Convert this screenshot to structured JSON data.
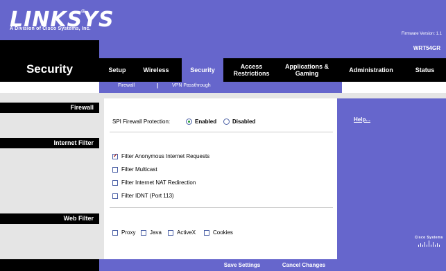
{
  "header": {
    "logo_text": "LINKSYS",
    "logo_reg": "®",
    "tagline": "A Division of Cisco Systems, Inc.",
    "firmware": "Firmware Version: 1.1"
  },
  "section_title": "Security",
  "model_name": "WRT54GR",
  "tabs": [
    {
      "label": "Setup",
      "active": false
    },
    {
      "label": "Wireless",
      "active": false
    },
    {
      "label": "Security",
      "active": true
    },
    {
      "label": "Access Restrictions",
      "active": false
    },
    {
      "label": "Applications & Gaming",
      "active": false
    },
    {
      "label": "Administration",
      "active": false
    },
    {
      "label": "Status",
      "active": false
    }
  ],
  "subtabs": [
    {
      "label": "Firewall"
    },
    {
      "label": "VPN Passthrough"
    }
  ],
  "subtab_separator": "|",
  "left_labels": {
    "firewall": "Firewall",
    "internet_filter": "Internet Filter",
    "web_filter": "Web Filter"
  },
  "firewall": {
    "spi_label": "SPI Firewall Protection:",
    "enabled_label": "Enabled",
    "disabled_label": "Disabled",
    "selected": "Enabled"
  },
  "internet_filter": {
    "items": [
      {
        "label": "Filter Anonymous Internet Requests",
        "checked": true
      },
      {
        "label": "Filter Multicast",
        "checked": false
      },
      {
        "label": "Filter Internet NAT Redirection",
        "checked": false
      },
      {
        "label": "Filter IDNT (Port 113)",
        "checked": false
      }
    ]
  },
  "web_filter": {
    "items": [
      {
        "label": "Proxy",
        "checked": false
      },
      {
        "label": "Java",
        "checked": false
      },
      {
        "label": "ActiveX",
        "checked": false
      },
      {
        "label": "Cookies",
        "checked": false
      }
    ]
  },
  "help": {
    "label": "Help..."
  },
  "brand_bottom": "Cisco Systems",
  "footer": {
    "save_label": "Save Settings",
    "cancel_label": "Cancel Changes"
  },
  "colors": {
    "purple": "#6666cc",
    "black": "#000000",
    "grey": "#e5e5e5"
  }
}
